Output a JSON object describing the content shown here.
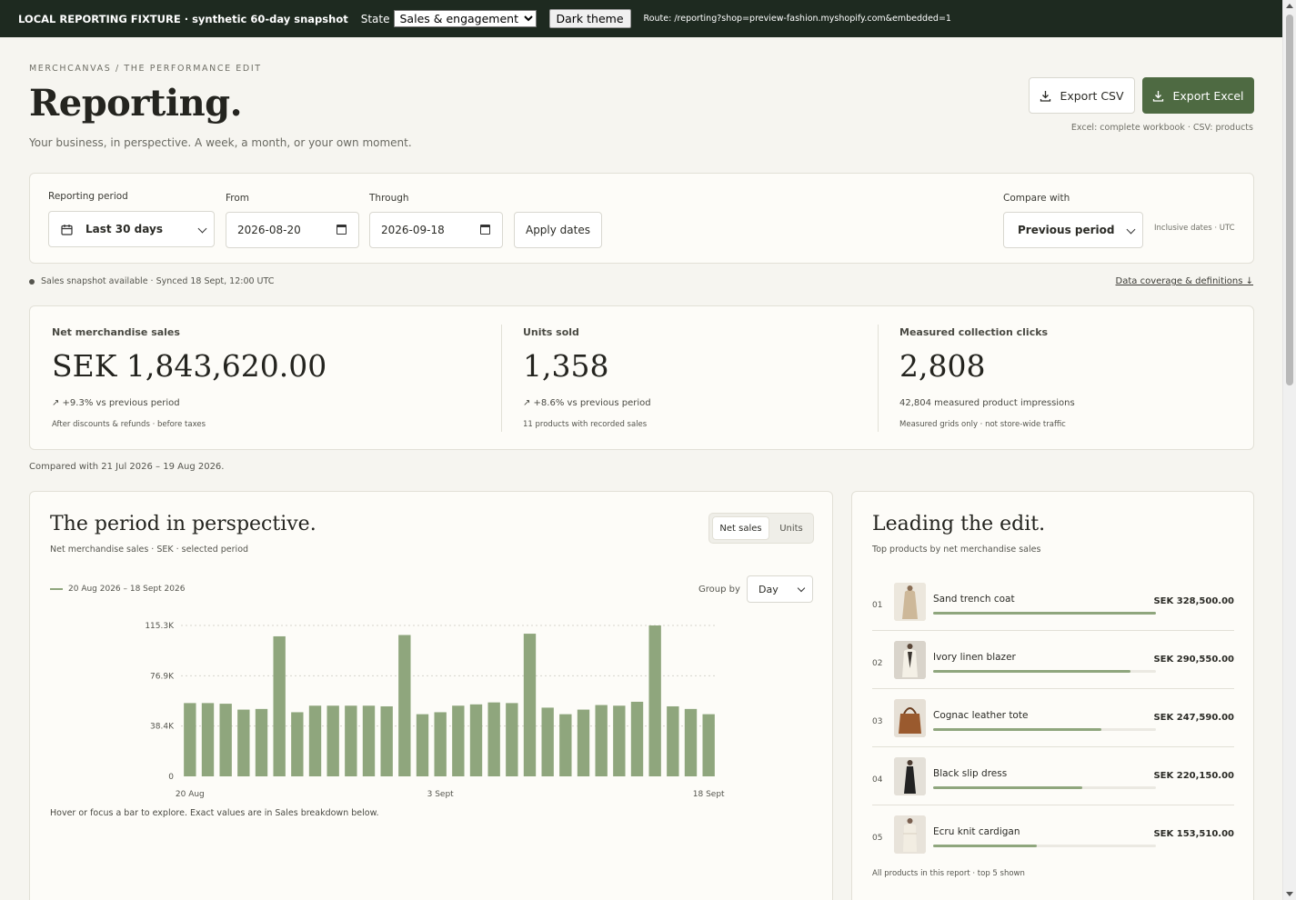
{
  "fixture": {
    "title": "LOCAL REPORTING FIXTURE · synthetic 60-day snapshot",
    "state_label": "State",
    "state_value": "Sales & engagement",
    "dark_theme_label": "Dark theme",
    "route": "Route: /reporting?shop=preview-fashion.myshopify.com&embedded=1"
  },
  "header": {
    "breadcrumb": "MERCHCANVAS / THE PERFORMANCE EDIT",
    "title": "Reporting.",
    "subtitle": "Your business, in perspective. A week, a month, or your own moment.",
    "export_csv": "Export CSV",
    "export_excel": "Export Excel",
    "export_note": "Excel: complete workbook · CSV: products"
  },
  "filters": {
    "period_label": "Reporting period",
    "period_value": "Last 30 days",
    "from_label": "From",
    "from_value": "2026-08-20",
    "through_label": "Through",
    "through_value": "2026-09-18",
    "apply_label": "Apply dates",
    "compare_label": "Compare with",
    "compare_value": "Previous period",
    "inclusive_note": "Inclusive dates · UTC"
  },
  "status": {
    "snapshot": "Sales snapshot available · Synced 18 Sept, 12:00 UTC",
    "coverage_link": "Data coverage & definitions ↓"
  },
  "kpis": [
    {
      "label": "Net merchandise sales",
      "value": "SEK 1,843,620.00",
      "delta": "↗ +9.3% vs previous period",
      "note": "After discounts & refunds · before taxes"
    },
    {
      "label": "Units sold",
      "value": "1,358",
      "delta": "↗ +8.6% vs previous period",
      "note": "11 products with recorded sales"
    },
    {
      "label": "Measured collection clicks",
      "value": "2,808",
      "delta": "42,804 measured product impressions",
      "note": "Measured grids only · not store-wide traffic"
    }
  ],
  "compared_text": "Compared with 21 Jul 2026 – 19 Aug 2026.",
  "chart_card": {
    "title": "The period in perspective.",
    "subtitle": "Net merchandise sales · SEK · selected period",
    "toggle_on": "Net sales",
    "toggle_off": "Units",
    "legend": "20 Aug 2026 – 18 Sept 2026",
    "groupby_label": "Group by",
    "groupby_value": "Day",
    "hint": "Hover or focus a bar to explore. Exact values are in Sales breakdown below."
  },
  "chart_data": {
    "type": "bar",
    "categories": [
      "20 Aug",
      "21 Aug",
      "22 Aug",
      "23 Aug",
      "24 Aug",
      "25 Aug",
      "26 Aug",
      "27 Aug",
      "28 Aug",
      "29 Aug",
      "30 Aug",
      "31 Aug",
      "1 Sept",
      "2 Sept",
      "3 Sept",
      "4 Sept",
      "5 Sept",
      "6 Sept",
      "7 Sept",
      "8 Sept",
      "9 Sept",
      "10 Sept",
      "11 Sept",
      "12 Sept",
      "13 Sept",
      "14 Sept",
      "15 Sept",
      "16 Sept",
      "17 Sept",
      "18 Sept"
    ],
    "x_tick_labels": [
      "20 Aug",
      "3 Sept",
      "18 Sept"
    ],
    "x_tick_index": [
      0,
      14,
      29
    ],
    "values": [
      56000,
      56000,
      55500,
      51000,
      51500,
      107000,
      49000,
      54000,
      54000,
      54000,
      54000,
      53500,
      108000,
      47500,
      49000,
      54000,
      55000,
      56500,
      56000,
      109000,
      52500,
      47500,
      51000,
      54500,
      54000,
      57000,
      115300,
      53500,
      51500,
      47500
    ],
    "y_ticks": [
      "0",
      "38.4K",
      "76.9K",
      "115.3K"
    ],
    "y_tick_values": [
      0,
      38433,
      76867,
      115300
    ],
    "ylim": [
      0,
      115300
    ],
    "color": "#8fa67d"
  },
  "products": {
    "title": "Leading the edit.",
    "subtitle": "Top products by net merchandise sales",
    "items": [
      {
        "rank": "01",
        "name": "Sand trench coat",
        "value": "SEK 328,500.00",
        "share": 1.0
      },
      {
        "rank": "02",
        "name": "Ivory linen blazer",
        "value": "SEK 290,550.00",
        "share": 0.885
      },
      {
        "rank": "03",
        "name": "Cognac leather tote",
        "value": "SEK 247,590.00",
        "share": 0.754
      },
      {
        "rank": "04",
        "name": "Black slip dress",
        "value": "SEK 220,150.00",
        "share": 0.67
      },
      {
        "rank": "05",
        "name": "Ecru knit cardigan",
        "value": "SEK 153,510.00",
        "share": 0.467
      }
    ],
    "footer": "All products in this report · top 5 shown"
  }
}
